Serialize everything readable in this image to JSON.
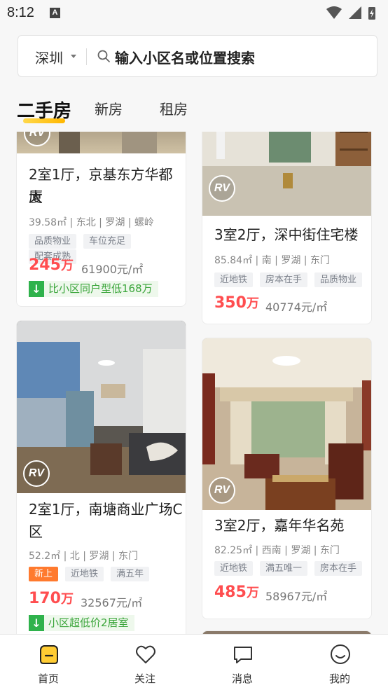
{
  "status": {
    "time": "8:12",
    "notif_letter": "A"
  },
  "search": {
    "city": "深圳",
    "placeholder": "输入小区名或位置搜索"
  },
  "tabs": [
    {
      "label": "二手房"
    },
    {
      "label": "新房"
    },
    {
      "label": "租房"
    }
  ],
  "listings": [
    {
      "title_line1": "2室1厅，京基东方华都大",
      "title_line2": "厦",
      "meta": "39.58㎡ | 东北 | 罗湖 | 螺岭",
      "tags": [
        "品质物业",
        "车位充足",
        "配套成熟"
      ],
      "price": "245",
      "price_unit": "万",
      "unit_price": "61900元/㎡",
      "promo": "比小区同户型低168万"
    },
    {
      "title_line1": "3室2厅，深中街住宅楼",
      "meta": "85.84㎡ | 南 | 罗湖 | 东门",
      "tags": [
        "近地铁",
        "房本在手",
        "品质物业"
      ],
      "price": "350",
      "price_unit": "万",
      "unit_price": "40774元/㎡"
    },
    {
      "title_line1": "2室1厅，南塘商业广场C",
      "title_line2": "区",
      "meta": "52.2㎡ | 北 | 罗湖 | 东门",
      "tags": [
        "新上",
        "近地铁",
        "满五年"
      ],
      "price": "170",
      "price_unit": "万",
      "unit_price": "32567元/㎡",
      "promo": "小区超低价2居室"
    },
    {
      "title_line1": "3室2厅，嘉年华名苑",
      "meta": "82.25㎡ | 西南 | 罗湖 | 东门",
      "tags": [
        "近地铁",
        "满五唯一",
        "房本在手"
      ],
      "price": "485",
      "price_unit": "万",
      "unit_price": "58967元/㎡"
    }
  ],
  "badge_text": "RV",
  "nav": [
    {
      "label": "首页"
    },
    {
      "label": "关注"
    },
    {
      "label": "消息"
    },
    {
      "label": "我的"
    }
  ],
  "colors": {
    "accent": "#ffcc33",
    "price": "#ff4d4f",
    "promo_green": "#2fb24c"
  }
}
